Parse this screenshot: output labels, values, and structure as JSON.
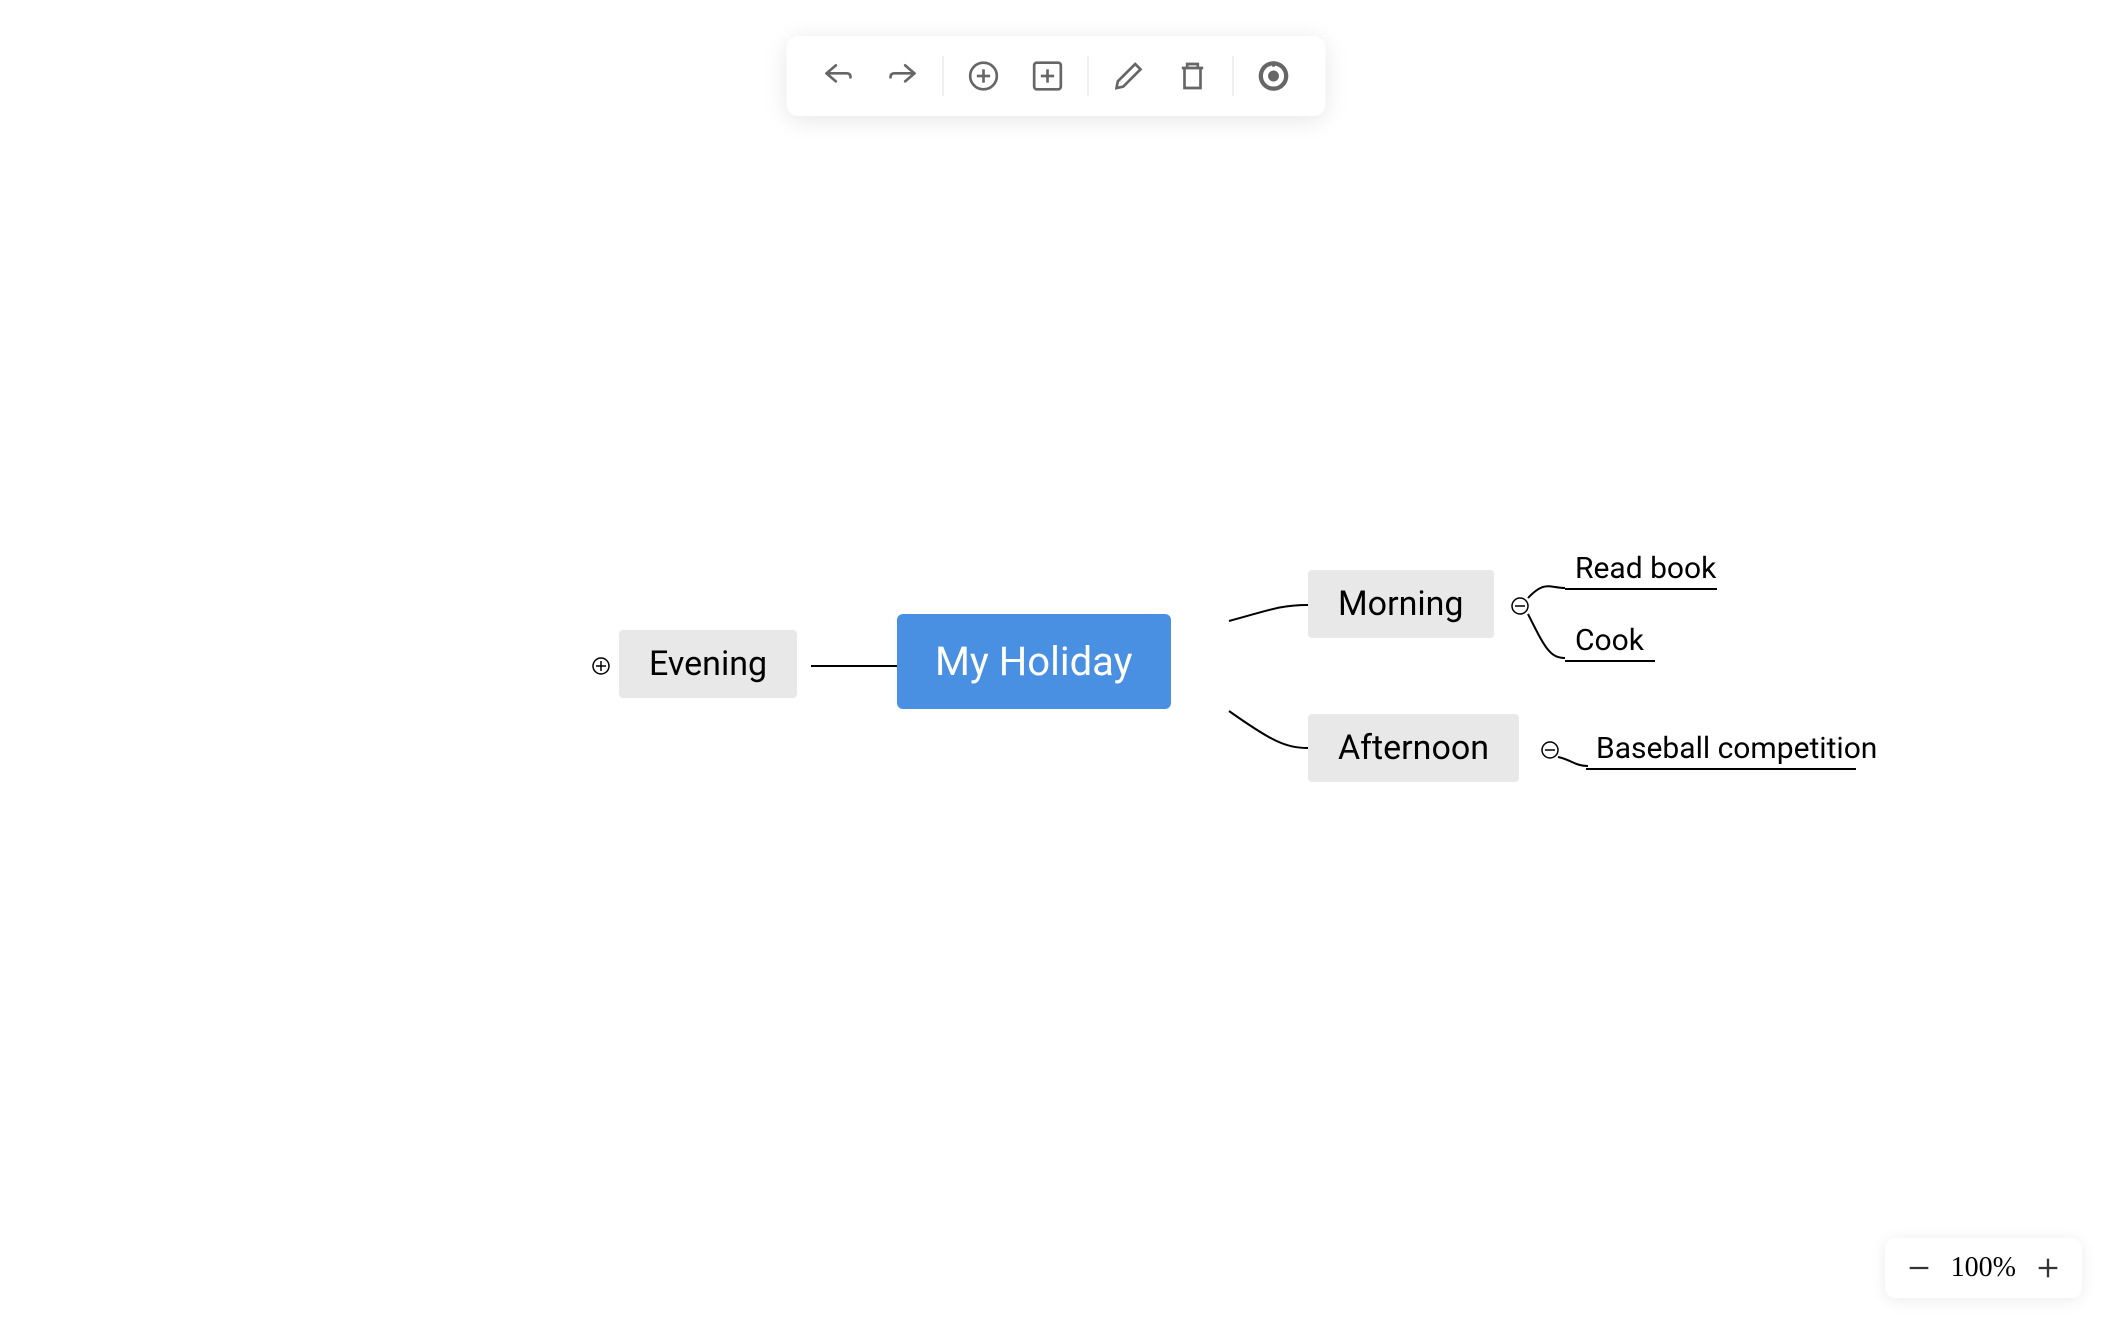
{
  "toolbar": {
    "undo": "undo",
    "redo": "redo",
    "add_child": "add-child",
    "add_sibling": "add-sibling",
    "edit": "edit",
    "delete": "delete",
    "focus": "focus"
  },
  "mindmap": {
    "root": {
      "label": "My Holiday",
      "color": "#4a90e2"
    },
    "left_branches": [
      {
        "label": "Evening",
        "expanded": false
      }
    ],
    "right_branches": [
      {
        "label": "Morning",
        "expanded": true,
        "children": [
          {
            "label": "Read book"
          },
          {
            "label": "Cook"
          }
        ]
      },
      {
        "label": "Afternoon",
        "expanded": true,
        "children": [
          {
            "label": "Baseball competition"
          }
        ]
      }
    ]
  },
  "zoom": {
    "value": "100%"
  }
}
